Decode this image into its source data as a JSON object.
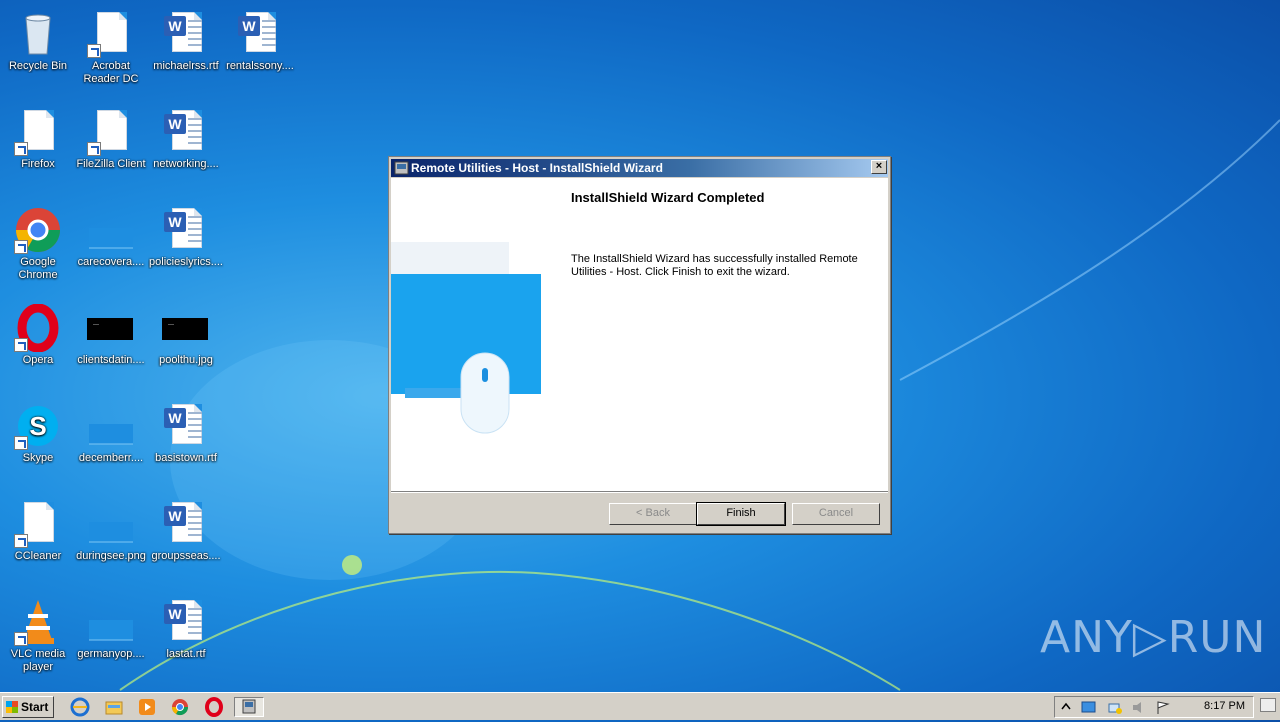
{
  "desktop": {
    "icons": [
      {
        "label": "Recycle Bin",
        "kind": "recycle-bin-icon"
      },
      {
        "label": "Acrobat Reader DC",
        "kind": "blank-file-shortcut-icon"
      },
      {
        "label": "michaelrss.rtf",
        "kind": "word-document-icon"
      },
      {
        "label": "rentalssony....",
        "kind": "word-document-icon"
      },
      {
        "label": "Firefox",
        "kind": "blank-file-shortcut-icon"
      },
      {
        "label": "FileZilla Client",
        "kind": "blank-file-shortcut-icon"
      },
      {
        "label": "networking....",
        "kind": "word-document-icon"
      },
      {
        "label": "Google Chrome",
        "kind": "chrome-icon"
      },
      {
        "label": "carecovera....",
        "kind": "image-thumbnail-icon"
      },
      {
        "label": "policieslyrics....",
        "kind": "word-document-icon"
      },
      {
        "label": "Opera",
        "kind": "opera-icon"
      },
      {
        "label": "clientsdatin....",
        "kind": "black-image-thumbnail-icon"
      },
      {
        "label": "poolthu.jpg",
        "kind": "black-image-thumbnail-icon"
      },
      {
        "label": "Skype",
        "kind": "skype-icon"
      },
      {
        "label": "decemberr....",
        "kind": "image-thumbnail-icon"
      },
      {
        "label": "basistown.rtf",
        "kind": "word-document-icon"
      },
      {
        "label": "CCleaner",
        "kind": "blank-file-shortcut-icon"
      },
      {
        "label": "duringsee.png",
        "kind": "image-thumbnail-icon"
      },
      {
        "label": "groupsseas....",
        "kind": "word-document-icon"
      },
      {
        "label": "VLC media player",
        "kind": "vlc-icon"
      },
      {
        "label": "germanyop....",
        "kind": "image-thumbnail-icon"
      },
      {
        "label": "lastat.rtf",
        "kind": "word-document-icon"
      }
    ]
  },
  "dialog": {
    "title": "Remote Utilities - Host - InstallShield Wizard",
    "close_label": "×",
    "heading": "InstallShield Wizard Completed",
    "message": "The InstallShield Wizard has successfully installed Remote Utilities - Host. Click Finish to exit the wizard.",
    "buttons": {
      "back": "< Back",
      "finish": "Finish",
      "cancel": "Cancel"
    }
  },
  "taskbar": {
    "start_label": "Start",
    "pinned": [
      "internet-explorer-icon",
      "file-explorer-icon",
      "media-player-icon",
      "chrome-icon",
      "opera-icon",
      "installer-icon"
    ],
    "clock": "8:17 PM"
  },
  "watermark": "ANY▷RUN",
  "colors": {
    "titlebar_start": "#0a246a",
    "titlebar_end": "#a6caf0",
    "desktop_blue": "#1e8ee0"
  }
}
